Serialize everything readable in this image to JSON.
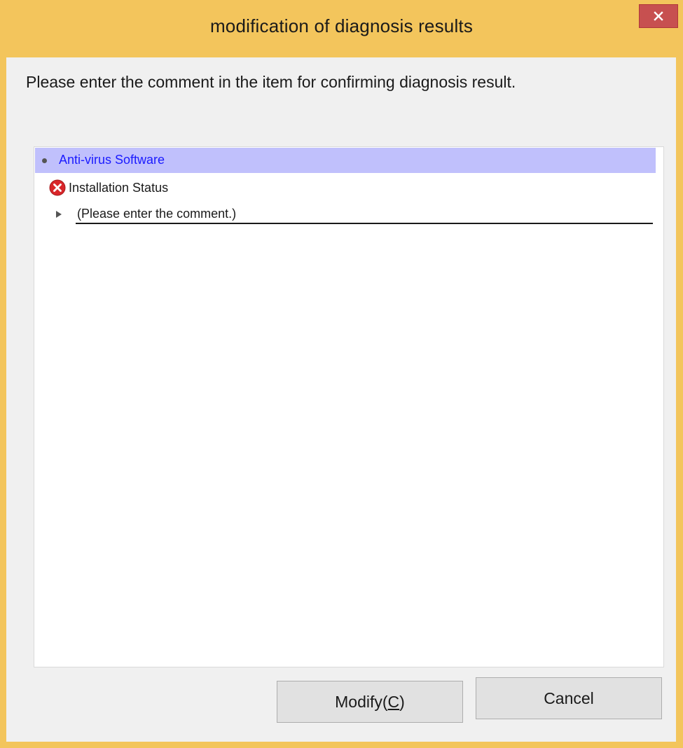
{
  "window": {
    "title": "modification of diagnosis results",
    "close_glyph": "×"
  },
  "instruction": "Please enter the comment in the item for confirming diagnosis result.",
  "list": {
    "category": {
      "label": "Anti-virus Software",
      "icon": "bullet-dot-icon"
    },
    "item": {
      "label": "Installation Status",
      "status_icon": "error-icon",
      "status_color": "#d9262a"
    },
    "comment": {
      "icon": "expander-triangle-icon",
      "value": "",
      "placeholder": "(Please enter the comment.)"
    }
  },
  "buttons": {
    "modify": {
      "label_prefix": "Modify(",
      "accelerator": "C",
      "label_suffix": ")"
    },
    "cancel": {
      "label": "Cancel"
    }
  },
  "colors": {
    "title_bar": "#f3c55c",
    "close_button": "#c75050",
    "selected_row": "#c0c0fc",
    "category_text": "#1a1aff"
  }
}
